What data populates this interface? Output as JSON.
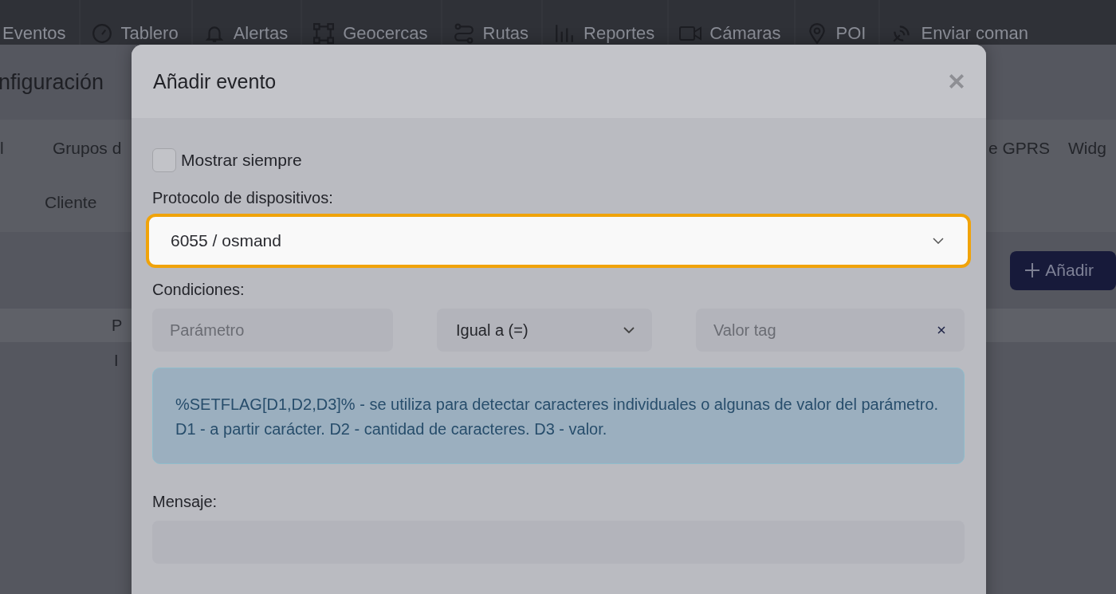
{
  "nav": {
    "items": [
      {
        "label": "Eventos"
      },
      {
        "label": "Tablero"
      },
      {
        "label": "Alertas"
      },
      {
        "label": "Geocercas"
      },
      {
        "label": "Rutas"
      },
      {
        "label": "Reportes"
      },
      {
        "label": "Cámaras"
      },
      {
        "label": "POI"
      },
      {
        "label": "Enviar coman"
      }
    ]
  },
  "page": {
    "title": "nfiguración",
    "tabs_row_1": [
      {
        "label": "l"
      },
      {
        "label": "Grupos d"
      },
      {
        "label": "e GPRS"
      },
      {
        "label": "Widg"
      }
    ],
    "tabs_row_2": [
      {
        "label": "Cliente"
      }
    ],
    "add_button": "Añadir",
    "table_header": "P",
    "table_row": "I"
  },
  "modal": {
    "title": "Añadir evento",
    "show_always": {
      "label": "Mostrar siempre",
      "checked": false
    },
    "protocol": {
      "label": "Protocolo de dispositivos:",
      "value": "6055 / osmand",
      "focused": true
    },
    "conditions": {
      "label": "Condiciones:",
      "parameter_placeholder": "Parámetro",
      "operator": "Igual a (=)",
      "value_placeholder": "Valor tag"
    },
    "info": "%SETFLAG[D1,D2,D3]% - se utiliza para detectar caracteres individuales o algunas de valor del parámetro. D1 - a partir carácter. D2 - cantidad de caracteres. D3 - valor.",
    "message": {
      "label": "Mensaje:"
    }
  }
}
